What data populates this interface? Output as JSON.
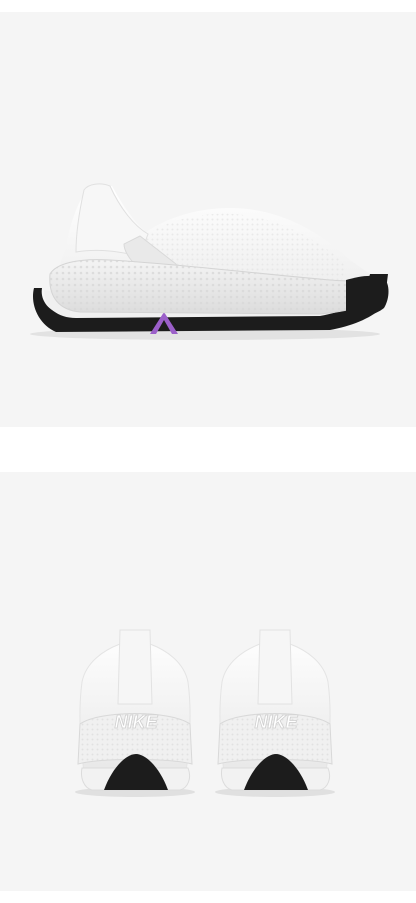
{
  "product_images": [
    {
      "view": "side",
      "background": "#f5f5f5"
    },
    {
      "view": "rear-pair",
      "background": "#f5f5f5"
    }
  ],
  "heel_logo_text": "NIKE",
  "colors": {
    "upper": "#fbfbfb",
    "midsole": "#eeeeee",
    "outsole": "#1c1c1c",
    "accent": "#9b5fc9"
  }
}
